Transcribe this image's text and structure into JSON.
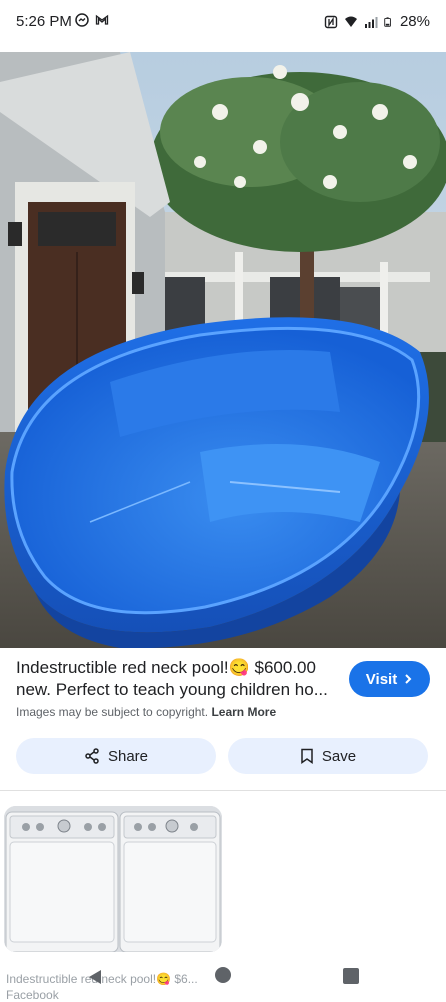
{
  "status_bar": {
    "time": "5:26 PM",
    "battery": "28%",
    "icons": [
      "facebook-messenger-icon",
      "gmail-icon",
      "nfc-icon",
      "wifi-icon",
      "signal-icon",
      "battery-icon"
    ]
  },
  "result": {
    "title_line1": "Indestructible red neck pool!😋 $600.00",
    "title_line2": "new. Perfect to teach young children ho...",
    "visit_label": "Visit",
    "copyright_text": "Images may be subject to copyright.",
    "learn_more": "Learn More",
    "share_label": "Share",
    "save_label": "Save"
  },
  "related": {
    "caption": "Indestructible red neck pool!😋 $6...",
    "source": "Facebook"
  },
  "colors": {
    "accent": "#1a73e8",
    "pill_bg": "#e8f0fe",
    "pool_blue": "#1e6fe0"
  }
}
